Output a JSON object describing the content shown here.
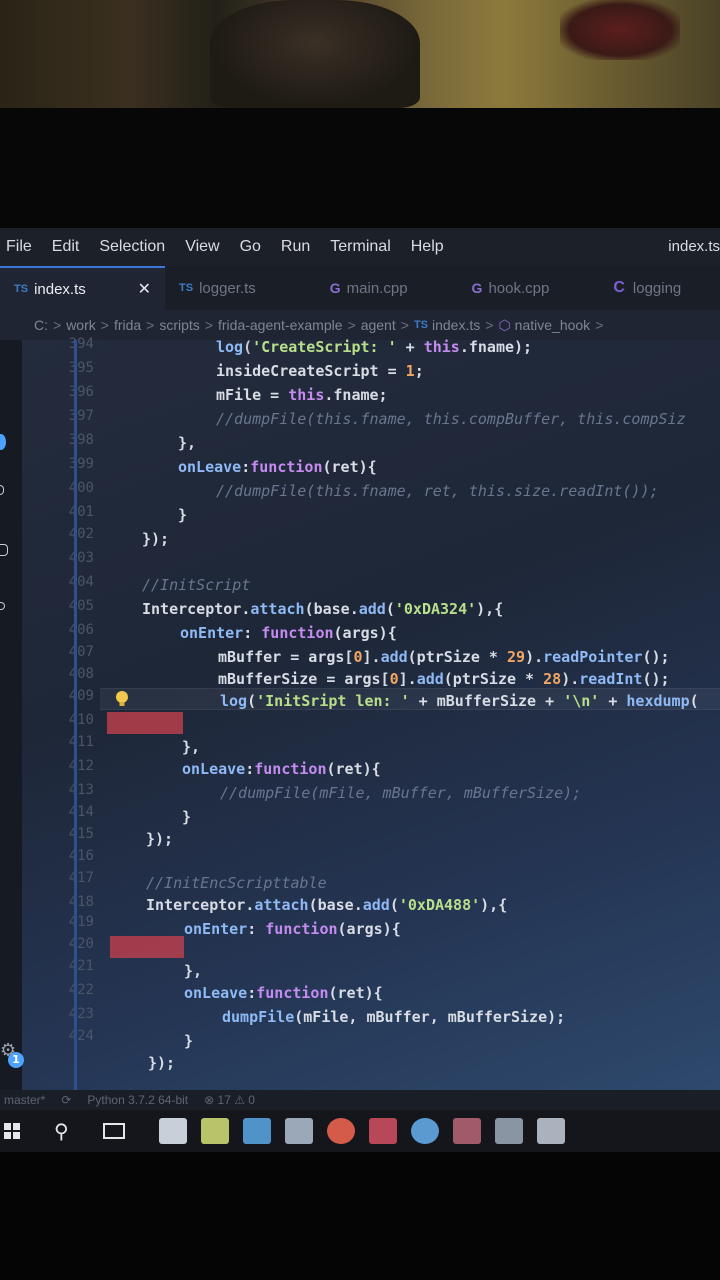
{
  "menu": [
    "File",
    "Edit",
    "Selection",
    "View",
    "Go",
    "Run",
    "Terminal",
    "Help"
  ],
  "window_title": "index.ts",
  "tabs": [
    {
      "icon": "TS",
      "label": "index.ts",
      "active": true
    },
    {
      "icon": "TS",
      "label": "logger.ts",
      "active": false
    },
    {
      "icon": "G",
      "label": "main.cpp",
      "active": false
    },
    {
      "icon": "G",
      "label": "hook.cpp",
      "active": false
    },
    {
      "icon": "C",
      "label": "logging",
      "active": false
    }
  ],
  "breadcrumb": [
    "C:",
    "work",
    "frida",
    "scripts",
    "frida-agent-example",
    "agent",
    "index.ts",
    "native_hook"
  ],
  "line_numbers": [
    "394",
    "395",
    "396",
    "397",
    "398",
    "399",
    "400",
    "401",
    "402",
    "403",
    "404",
    "405",
    "406",
    "407",
    "408",
    "409",
    "410",
    "411",
    "412",
    "413",
    "414",
    "415",
    "416",
    "417",
    "418",
    "419",
    "420",
    "421",
    "422",
    "423",
    "424"
  ],
  "status": {
    "branch": "master*",
    "python": "Python 3.7.2 64-bit",
    "problems": "⊗ 17 ⚠ 0"
  },
  "colors": {
    "accent": "#3c78d8",
    "marker": "#c0404c"
  }
}
